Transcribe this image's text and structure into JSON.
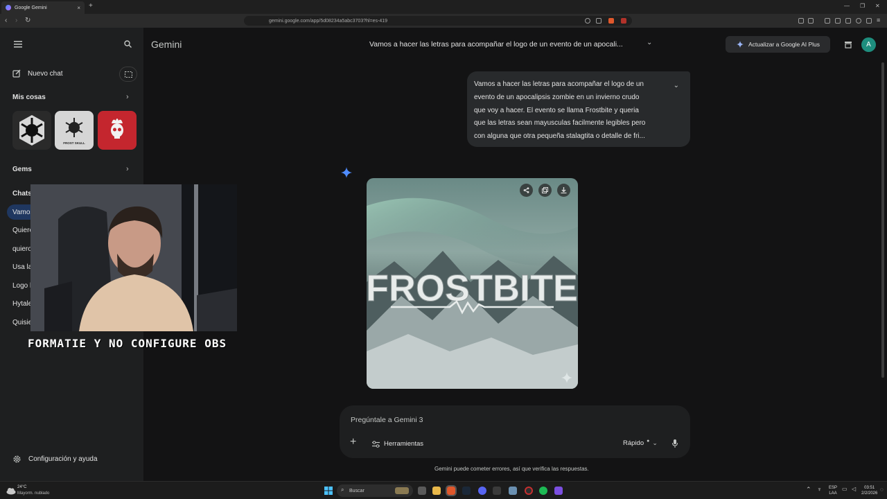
{
  "browser": {
    "tab_title": "Google Gemini",
    "url": "gemini.google.com/app/5d08234a5abc3703?hl=es-419",
    "new_tab_label": "+",
    "close_tab_label": "×"
  },
  "sidebar": {
    "new_chat": "Nuevo chat",
    "my_stuff": "Mis cosas",
    "thumb_label": "FROST SKULL",
    "gems": "Gems",
    "chats_header": "Chats",
    "chats": [
      "Vamos",
      "Quiere",
      "quiero",
      "Usa la",
      "Logo l",
      "Hytale",
      "Quisie"
    ],
    "settings": "Configuración y ayuda"
  },
  "overlay": {
    "caption": "FORMATIE Y NO CONFIGURE OBS"
  },
  "main": {
    "brand": "Gemini",
    "conversation_title": "Vamos a hacer las letras para acompañar el logo de un evento de un apocali...",
    "upgrade_label": "Actualizar a Google AI Plus",
    "avatar_letter": "A",
    "user_message_lines": [
      "Vamos a hacer las letras para acompañar el logo de un",
      "evento de un apocalipsis zombie en un invierno crudo",
      "que voy a hacer. El evento se llama Frostbite y queria",
      "que las letras sean mayusculas facilmente legibles pero",
      "con alguna que otra pequeña stalagtita o detalle de fri..."
    ],
    "image_text": "FROSTBITE",
    "input_placeholder": "Pregúntale a Gemini 3",
    "tools_label": "Herramientas",
    "mode_label": "Rápido",
    "disclaimer": "Gemini puede cometer errores, así que verifica las respuestas."
  },
  "taskbar": {
    "weather_temp": "24°C",
    "weather_desc": "Mayorm. nublado",
    "search_label": "Buscar",
    "lang_top": "ESP",
    "lang_bottom": "LAA",
    "time": "03:51",
    "date": "2/2/2026"
  },
  "colors": {
    "accent": "#1f3760",
    "gemini_spark": "#4f8cff",
    "avatar_bg": "#1e8e7e"
  }
}
